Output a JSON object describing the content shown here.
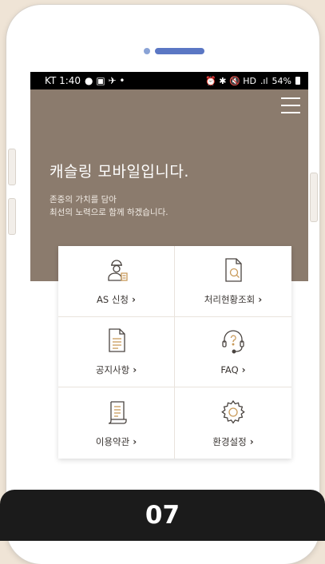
{
  "statusbar": {
    "carrier_time": "KT 1:40",
    "left_icons": "● ▣ ✈ •",
    "right_icons": "⏰ ✱ 🔇 HD ",
    "battery": "54%"
  },
  "hero": {
    "title": "캐슬링 모바일입니다.",
    "subtitle_line1": "존중의 가치를 담아",
    "subtitle_line2": "최선의 노력으로 함께 하겠습니다."
  },
  "menu": {
    "items": [
      {
        "label": "AS 신청",
        "icon": "technician-icon"
      },
      {
        "label": "처리현황조회",
        "icon": "document-search-icon"
      },
      {
        "label": "공지사항",
        "icon": "notice-document-icon"
      },
      {
        "label": "FAQ",
        "icon": "headset-question-icon"
      },
      {
        "label": "이용약관",
        "icon": "terms-scroll-icon"
      },
      {
        "label": "환경설정",
        "icon": "gear-icon"
      }
    ]
  },
  "banner": {
    "number": "07"
  },
  "colors": {
    "hero": "#8b7b6d",
    "accent_blue": "#5b77c4",
    "background": "#efe4d6"
  }
}
